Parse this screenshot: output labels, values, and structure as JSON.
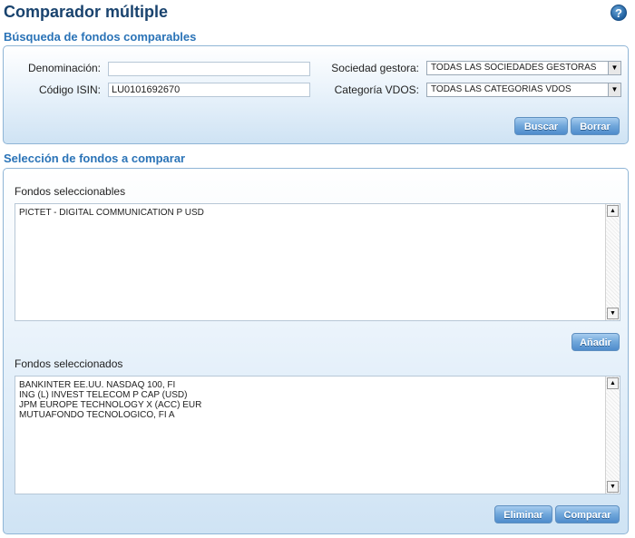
{
  "header": {
    "title": "Comparador múltiple",
    "help_glyph": "?"
  },
  "search": {
    "title": "Búsqueda de fondos comparables",
    "denominacion_label": "Denominación:",
    "denominacion_value": "",
    "isin_label": "Código ISIN:",
    "isin_value": "LU0101692670",
    "gestora_label": "Sociedad gestora:",
    "gestora_value": "TODAS LAS SOCIEDADES GESTORAS",
    "categoria_label": "Categoría VDOS:",
    "categoria_value": "TODAS LAS CATEGORIAS VDOS",
    "buscar_label": "Buscar",
    "borrar_label": "Borrar"
  },
  "selection": {
    "title": "Selección de fondos a comparar",
    "selectable_label": "Fondos seleccionables",
    "selectable_items": [
      "PICTET - DIGITAL COMMUNICATION P USD"
    ],
    "add_label": "Añadir",
    "selected_label": "Fondos seleccionados",
    "selected_items": [
      "BANKINTER EE.UU. NASDAQ 100, FI",
      "ING (L) INVEST TELECOM P CAP (USD)",
      "JPM EUROPE TECHNOLOGY X (ACC) EUR",
      "MUTUAFONDO TECNOLOGICO, FI A"
    ],
    "remove_label": "Eliminar",
    "compare_label": "Comparar"
  },
  "icons": {
    "help": "help-icon",
    "dropdown": "dropdown-arrow-icon",
    "scroll_up": "scroll-up-icon",
    "scroll_down": "scroll-down-icon"
  },
  "colors": {
    "title": "#19436e",
    "section_title": "#2a73b7",
    "button": "#6fa6da",
    "panel_border": "#8fb5d6"
  }
}
